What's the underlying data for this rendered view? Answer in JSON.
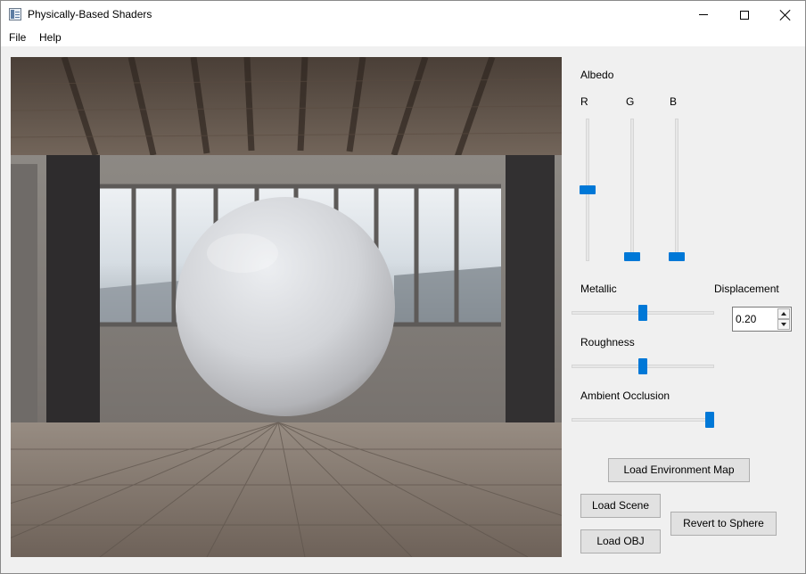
{
  "window": {
    "title": "Physically-Based Shaders"
  },
  "menu": {
    "file": "File",
    "help": "Help"
  },
  "controls": {
    "albedo_label": "Albedo",
    "r_label": "R",
    "g_label": "G",
    "b_label": "B",
    "albedo_r": 0.5,
    "albedo_g": 0.0,
    "albedo_b": 0.0,
    "metallic_label": "Metallic",
    "metallic": 0.5,
    "displacement_label": "Displacement",
    "displacement_value": "0.20",
    "roughness_label": "Roughness",
    "roughness": 0.5,
    "ao_label": "Ambient Occlusion",
    "ambient_occlusion": 1.0,
    "accent_color": "#0078d7"
  },
  "buttons": {
    "load_env": "Load Environment Map",
    "load_scene": "Load Scene",
    "load_obj": "Load OBJ",
    "revert": "Revert to Sphere"
  }
}
